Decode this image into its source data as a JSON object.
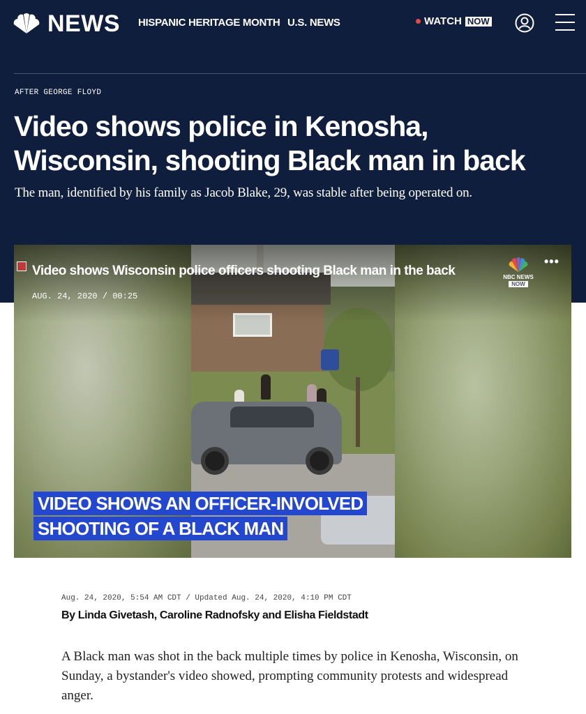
{
  "header": {
    "logo_text": "NEWS",
    "nav_links": [
      "HISPANIC HERITAGE MONTH",
      "U.S. NEWS"
    ],
    "watch_label": "WATCH",
    "watch_badge": "NOW"
  },
  "article": {
    "eyebrow": "AFTER GEORGE FLOYD",
    "headline": "Video shows police in Kenosha, Wisconsin, shooting Black man in back",
    "dek": "The man, identified by his family as Jacob Blake, 29, was stable after being operated on.",
    "byline_meta": "Aug. 24, 2020, 5:54 AM CDT / Updated Aug. 24, 2020, 4:10 PM CDT",
    "authors": "By Linda Givetash, Caroline Radnofsky and Elisha Fieldstadt",
    "body": "A Black man was shot in the back multiple times by police in Kenosha, Wisconsin, on Sunday, a bystander's video showed, prompting community protests and widespread anger."
  },
  "video": {
    "title": "Video shows Wisconsin police officers shooting Black man in the back",
    "date_duration": "AUG. 24, 2020 / 00:25",
    "more_label": "•••",
    "bug_text": "NBC NEWS",
    "bug_badge": "NOW",
    "chyron_line1": "VIDEO SHOWS AN OFFICER-INVOLVED",
    "chyron_line2": "SHOOTING OF A BLACK MAN"
  },
  "colors": {
    "header_bg": "#0f1e3d",
    "chyron_bg": "#2447cf",
    "live_dot": "#e34b4b"
  }
}
